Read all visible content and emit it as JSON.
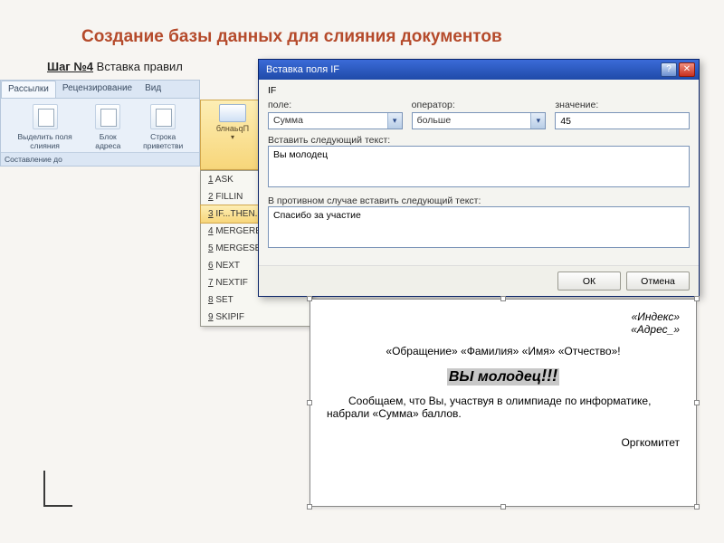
{
  "title": "Создание базы данных для слияния документов",
  "step": {
    "label": "Шаг №4",
    "text": "Вставка правил"
  },
  "ribbon": {
    "tabs": [
      "Рассылки",
      "Рецензирование",
      "Вид"
    ],
    "active_tab": "Рассылки",
    "items": [
      {
        "label": "Выделить поля слияния"
      },
      {
        "label": "Блок адреса"
      },
      {
        "label": "Строка приветстви"
      }
    ],
    "footer": "Составление до",
    "rules_button": "блнаьqП"
  },
  "rules_menu": [
    {
      "key": "1",
      "label": "ASK"
    },
    {
      "key": "2",
      "label": "FILLIN"
    },
    {
      "key": "3",
      "label": "IF...THEN...ELSE",
      "selected": true
    },
    {
      "key": "4",
      "label": "MERGEREC"
    },
    {
      "key": "5",
      "label": "MERGESEQ"
    },
    {
      "key": "6",
      "label": "NEXT"
    },
    {
      "key": "7",
      "label": "NEXTIF"
    },
    {
      "key": "8",
      "label": "SET"
    },
    {
      "key": "9",
      "label": "SKIPIF"
    }
  ],
  "dialog": {
    "title": "Вставка поля IF",
    "if_label": "IF",
    "field_label": "поле:",
    "field_value": "Сумма",
    "operator_label": "оператор:",
    "operator_value": "больше",
    "value_label": "значение:",
    "value_value": "45",
    "insert_text_label": "Вставить следующий текст:",
    "insert_text_value": "Вы молодец",
    "else_text_label": "В противном случае вставить следующий текст:",
    "else_text_value": "Спасибо за участие",
    "ok": "ОК",
    "cancel": "Отмена"
  },
  "document": {
    "index": "«Индекс»",
    "address": "«Адрес_»",
    "greeting": "«Обращение» «Фамилия» «Имя» «Отчество»!",
    "highlight_pre": "ВЫ молодец",
    "highlight_post": "!!!",
    "body": "Сообщаем, что Вы, участвуя в олимпиаде по информатике, набрали «Сумма» баллов.",
    "signature": "Оргкомитет"
  }
}
